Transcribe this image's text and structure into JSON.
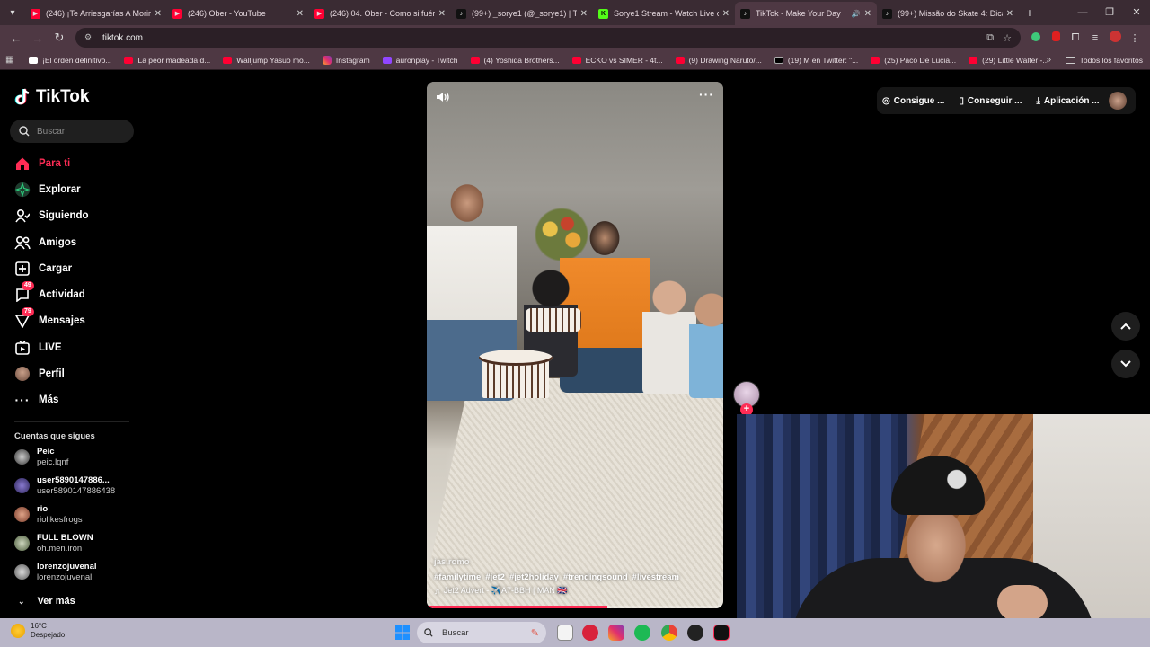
{
  "browser": {
    "tabs": [
      {
        "title": "(246) ¡Te Arriesgarías A Morir P",
        "favicon": "youtube-icon",
        "active": false
      },
      {
        "title": "(246) Ober - YouTube",
        "favicon": "youtube-icon",
        "active": false
      },
      {
        "title": "(246) 04. Ober - Como si fuéran",
        "favicon": "youtube-icon",
        "active": false
      },
      {
        "title": "(99+) _sorye1 (@_sorye1) | TikTo",
        "favicon": "tiktok-icon",
        "active": false
      },
      {
        "title": "Sorye1 Stream - Watch Live on",
        "favicon": "kick-icon",
        "active": false
      },
      {
        "title": "TikTok - Make Your Day",
        "favicon": "tiktok-icon",
        "active": true,
        "audio": true
      },
      {
        "title": "(99+) Missão do Skate 4: Dicas",
        "favicon": "tiktok-icon",
        "active": false
      }
    ],
    "url": "tiktok.com",
    "bookmarks": [
      {
        "label": "¡El orden definitivo...",
        "type": "doc"
      },
      {
        "label": "La peor madeada d...",
        "type": "yt"
      },
      {
        "label": "Walljump Yasuo mo...",
        "type": "yt"
      },
      {
        "label": "Instagram",
        "type": "ig"
      },
      {
        "label": "auronplay - Twitch",
        "type": "tw"
      },
      {
        "label": "(4) Yoshida Brothers...",
        "type": "yt"
      },
      {
        "label": "ECKO vs SIMER - 4t...",
        "type": "yt"
      },
      {
        "label": "(9) Drawing Naruto/...",
        "type": "yt"
      },
      {
        "label": "(19) M en Twitter: \"...",
        "type": "x"
      },
      {
        "label": "(25) Paco De Lucia...",
        "type": "yt"
      },
      {
        "label": "(29) Little Walter -...",
        "type": "yt"
      }
    ],
    "bookmarks_folder": "Todos los favoritos"
  },
  "tiktok": {
    "logo": "TikTok",
    "search_placeholder": "Buscar",
    "nav": [
      {
        "label": "Para ti",
        "icon": "home-icon",
        "active": true
      },
      {
        "label": "Explorar",
        "icon": "compass-icon"
      },
      {
        "label": "Siguiendo",
        "icon": "following-icon"
      },
      {
        "label": "Amigos",
        "icon": "friends-icon"
      },
      {
        "label": "Cargar",
        "icon": "upload-icon"
      },
      {
        "label": "Actividad",
        "icon": "activity-icon",
        "badge": "49"
      },
      {
        "label": "Mensajes",
        "icon": "messages-icon",
        "badge": "79"
      },
      {
        "label": "LIVE",
        "icon": "live-icon"
      },
      {
        "label": "Perfil",
        "icon": "profile-avatar"
      },
      {
        "label": "Más",
        "icon": "more-icon"
      }
    ],
    "following_header": "Cuentas que sigues",
    "following": [
      {
        "username": "Peic",
        "name": "peic.lqnf"
      },
      {
        "username": "user5890147886...",
        "name": "user5890147886438"
      },
      {
        "username": "rio",
        "name": "riolikesfrogs"
      },
      {
        "username": "FULL BLOWN",
        "name": "oh.men.iron"
      },
      {
        "username": "lorenzojuvenal",
        "name": "lorenzojuvenal"
      }
    ],
    "see_more": "Ver más",
    "video": {
      "author": "jas.romo",
      "hashtags": [
        "#familytime",
        "#jet2",
        "#jet2holiday",
        "#trendingsound",
        "#livestream"
      ],
      "music": "Jet2 Advert - ✈️A7-BBH | MAN 🇬🇧",
      "progress": 0.61
    },
    "top_buttons": [
      {
        "label": "Consigue ...",
        "icon": "coin-icon"
      },
      {
        "label": "Conseguir ...",
        "icon": "phone-icon"
      },
      {
        "label": "Aplicación ...",
        "icon": "download-icon"
      }
    ]
  },
  "taskbar": {
    "weather_temp": "16°C",
    "weather_desc": "Despejado",
    "search_placeholder": "Buscar"
  },
  "colors": {
    "accent": "#fe2c55",
    "tab_bg": "#3a2b33",
    "toolbar_bg": "#4e3843"
  }
}
